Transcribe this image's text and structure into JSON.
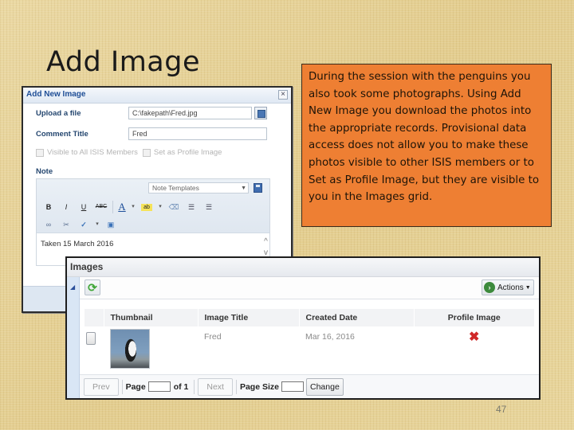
{
  "slide": {
    "title": "Add Image",
    "page_number": "47",
    "callout_text": "During the session with the penguins you also took some photographs. Using Add New Image you download the photos into the appropriate records. Provisional data access does not allow you to make these photos visible to other ISIS members or to Set as Profile Image, but they are visible to you in the Images grid."
  },
  "dialog": {
    "title": "Add New Image",
    "close_icon": "×",
    "upload_label": "Upload a file",
    "upload_value": "C:\\fakepath\\Fred.jpg",
    "comment_label": "Comment Title",
    "comment_value": "Fred",
    "checkbox_visible_label": "Visible to All ISIS Members",
    "checkbox_profile_label": "Set as Profile Image",
    "note_label": "Note",
    "note_templates_placeholder": "Note Templates",
    "note_text": "Taken 15 March 2016",
    "toolbar": {
      "bold": "B",
      "italic": "I",
      "underline": "U",
      "strikethrough": "ABC",
      "font_color": "A",
      "highlight": "ab",
      "eraser": "⌫",
      "bullet_list": "☰",
      "numbered_list": "☰",
      "link": "∞",
      "unlink": "✂",
      "spellcheck": "✓",
      "dropdown": "▾",
      "image": "▣"
    }
  },
  "grid": {
    "title": "Images",
    "actions_label": "Actions",
    "refresh_icon": "⟳",
    "columns": [
      "Thumbnail",
      "Image Title",
      "Created Date",
      "Profile Image"
    ],
    "rows": [
      {
        "image_title": "Fred",
        "created_date": "Mar 16, 2016",
        "profile_image": "✖"
      }
    ],
    "pager": {
      "prev_label": "Prev",
      "page_label": "Page",
      "of_label": "of 1",
      "next_label": "Next",
      "page_size_label": "Page Size",
      "change_label": "Change"
    }
  }
}
